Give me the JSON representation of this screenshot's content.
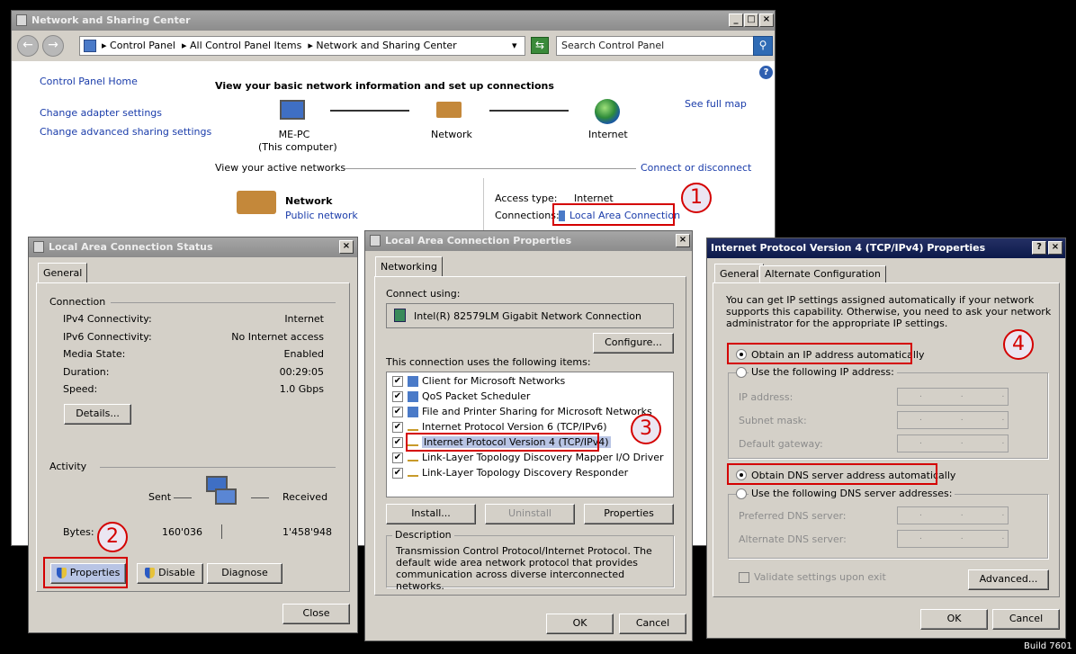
{
  "nsc": {
    "title": "Network and Sharing Center",
    "breadcrumb": [
      "Control Panel",
      "All Control Panel Items",
      "Network and Sharing Center"
    ],
    "search_placeholder": "Search Control Panel",
    "sidebar": [
      "Control Panel Home",
      "Change adapter settings",
      "Change advanced sharing settings"
    ],
    "heading": "View your basic network information and set up connections",
    "see_full_map": "See full map",
    "map": {
      "computer": "ME-PC",
      "computer_sub": "(This computer)",
      "network": "Network",
      "internet": "Internet"
    },
    "active_networks": "View your active networks",
    "connect_or_disconnect": "Connect or disconnect",
    "net_name": "Network",
    "net_type": "Public network",
    "access_type_label": "Access type:",
    "access_type_value": "Internet",
    "connections_label": "Connections:",
    "connections_value": "Local Area Connection"
  },
  "status": {
    "title": "Local Area Connection Status",
    "tab": "General",
    "connection_group": "Connection",
    "rows": [
      {
        "label": "IPv4 Connectivity:",
        "value": "Internet"
      },
      {
        "label": "IPv6 Connectivity:",
        "value": "No Internet access"
      },
      {
        "label": "Media State:",
        "value": "Enabled"
      },
      {
        "label": "Duration:",
        "value": "00:29:05"
      },
      {
        "label": "Speed:",
        "value": "1.0 Gbps"
      }
    ],
    "details_btn": "Details...",
    "activity_group": "Activity",
    "sent_label": "Sent",
    "received_label": "Received",
    "bytes_label": "Bytes:",
    "bytes_sent": "160'036",
    "bytes_received": "1'458'948",
    "properties_btn": "Properties",
    "disable_btn": "Disable",
    "diagnose_btn": "Diagnose",
    "close_btn": "Close"
  },
  "props": {
    "title": "Local Area Connection Properties",
    "tab": "Networking",
    "connect_using_label": "Connect using:",
    "adapter": "Intel(R) 82579LM Gigabit Network Connection",
    "configure_btn": "Configure...",
    "items_label": "This connection uses the following items:",
    "items": [
      "Client for Microsoft Networks",
      "QoS Packet Scheduler",
      "File and Printer Sharing for Microsoft Networks",
      "Internet Protocol Version 6 (TCP/IPv6)",
      "Internet Protocol Version 4 (TCP/IPv4)",
      "Link-Layer Topology Discovery Mapper I/O Driver",
      "Link-Layer Topology Discovery Responder"
    ],
    "install_btn": "Install...",
    "uninstall_btn": "Uninstall",
    "properties_btn": "Properties",
    "description_group": "Description",
    "description": "Transmission Control Protocol/Internet Protocol. The default wide area network protocol that provides communication across diverse interconnected networks.",
    "ok_btn": "OK",
    "cancel_btn": "Cancel"
  },
  "ipv4": {
    "title": "Internet Protocol Version 4 (TCP/IPv4) Properties",
    "tab_general": "General",
    "tab_alternate": "Alternate Configuration",
    "intro": "You can get IP settings assigned automatically if your network supports this capability. Otherwise, you need to ask your network administrator for the appropriate IP settings.",
    "obtain_ip_auto": "Obtain an IP address automatically",
    "use_following_ip": "Use the following IP address:",
    "ip_address": "IP address:",
    "subnet_mask": "Subnet mask:",
    "default_gateway": "Default gateway:",
    "obtain_dns_auto": "Obtain DNS server address automatically",
    "use_following_dns": "Use the following DNS server addresses:",
    "preferred_dns": "Preferred DNS server:",
    "alternate_dns": "Alternate DNS server:",
    "validate": "Validate settings upon exit",
    "advanced_btn": "Advanced...",
    "ok_btn": "OK",
    "cancel_btn": "Cancel"
  },
  "annotations": [
    "1",
    "2",
    "3",
    "4"
  ],
  "build": "Build 7601"
}
